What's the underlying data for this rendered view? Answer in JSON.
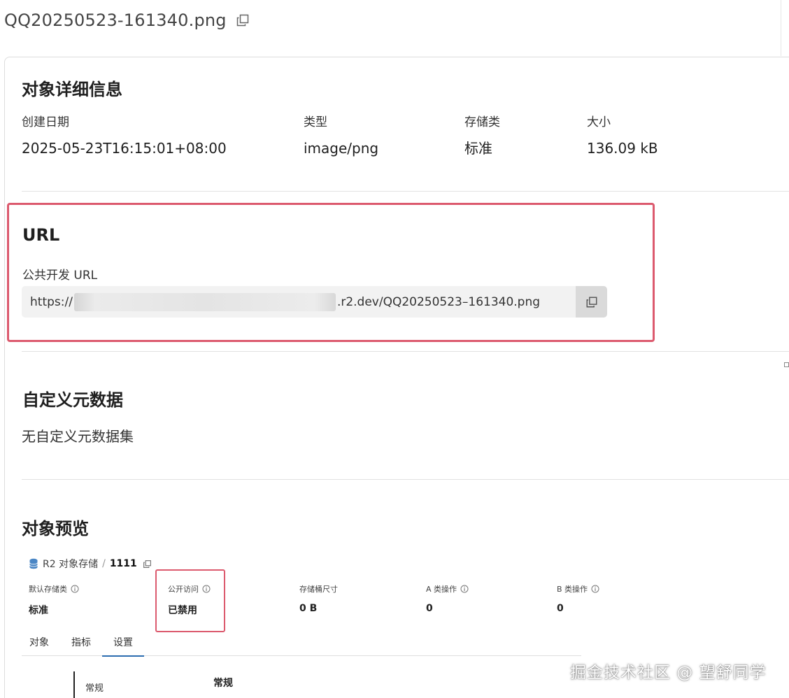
{
  "header": {
    "file_name": "QQ20250523-161340.png",
    "copy_icon": "copy-icon"
  },
  "details": {
    "title": "对象详细信息",
    "fields": [
      {
        "label": "创建日期",
        "value": "2025-05-23T16:15:01+08:00"
      },
      {
        "label": "类型",
        "value": "image/png"
      },
      {
        "label": "存储类",
        "value": "标准"
      },
      {
        "label": "大小",
        "value": "136.09 kB"
      }
    ]
  },
  "url_section": {
    "title": "URL",
    "public_label": "公共开发 URL",
    "url_prefix": "https://",
    "url_suffix": ".r2.dev/QQ20250523–161340.png",
    "copy_icon": "copy-icon"
  },
  "metadata": {
    "title": "自定义元数据",
    "empty_text": "无自定义元数据集"
  },
  "preview": {
    "title": "对象预览",
    "breadcrumb": {
      "service": "R2 对象存储",
      "separator": "/",
      "bucket": "1111",
      "icon": "database-icon"
    },
    "stats": [
      {
        "label": "默认存储类",
        "value": "标准",
        "has_info": true
      },
      {
        "label": "公开访问",
        "value": "已禁用",
        "has_info": true
      },
      {
        "label": "存储桶尺寸",
        "value": "0 B",
        "has_info": false
      },
      {
        "label": "A 类操作",
        "value": "0",
        "has_info": true
      },
      {
        "label": "B 类操作",
        "value": "0",
        "has_info": true
      }
    ],
    "tabs": [
      {
        "label": "对象",
        "active": false
      },
      {
        "label": "指标",
        "active": false
      },
      {
        "label": "设置",
        "active": true
      }
    ],
    "settings_nav_item": "常规",
    "settings_heading": "常规"
  },
  "watermark": "掘金技术社区 @ 望舒同学",
  "colors": {
    "highlight": "#dc5a6e",
    "tab_active": "#2b6cb0",
    "url_bg": "#f2f2f2"
  }
}
